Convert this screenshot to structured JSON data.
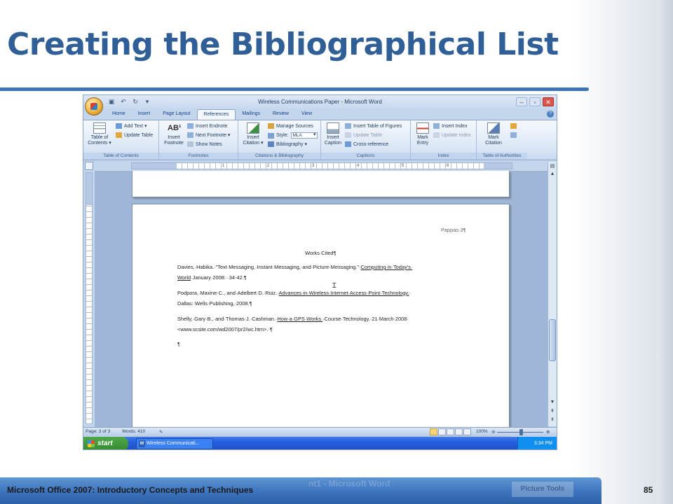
{
  "slide": {
    "title": "Creating the Bibliographical List",
    "footer": "Microsoft Office 2007: Introductory Concepts and Techniques",
    "page_number": "85",
    "footer_ghost_text": "nt1 - Microsoft Word",
    "footer_ghost_tab": "Picture Tools"
  },
  "window": {
    "title": "Wireless Communications Paper - Microsoft Word",
    "controls": {
      "minimize": "–",
      "maximize": "▫",
      "close": "✕"
    },
    "help": "?"
  },
  "ribbon": {
    "tabs": [
      "Home",
      "Insert",
      "Page Layout",
      "References",
      "Mailings",
      "Review",
      "View"
    ],
    "active_tab": "References",
    "groups": {
      "toc": {
        "label": "Table of Contents",
        "toc_button": "Table of Contents ▾",
        "add_text": "Add Text ▾",
        "update_table": "Update Table"
      },
      "footnotes": {
        "label": "Footnotes",
        "insert_footnote": "Insert Footnote",
        "insert_endnote": "Insert Endnote",
        "next_footnote": "Next Footnote ▾",
        "show_notes": "Show Notes"
      },
      "citations": {
        "label": "Citations & Bibliography",
        "insert_citation": "Insert Citation ▾",
        "manage_sources": "Manage Sources",
        "style_label": "Style:",
        "style_value": "MLA",
        "bibliography": "Bibliography ▾"
      },
      "captions": {
        "label": "Captions",
        "insert_caption": "Insert Caption",
        "insert_table_of_figures": "Insert Table of Figures",
        "update_table": "Update Table",
        "cross_reference": "Cross-reference"
      },
      "index": {
        "label": "Index",
        "mark_entry": "Mark Entry",
        "insert_index": "Insert Index",
        "update_index": "Update Index"
      },
      "authorities": {
        "label": "Table of Authorities",
        "mark_citation": "Mark Citation"
      }
    }
  },
  "ruler": {
    "numbers": [
      "1",
      "2",
      "3",
      "4",
      "5",
      "6"
    ]
  },
  "document": {
    "header": "Pappas·3¶",
    "heading": "Works·Cited¶",
    "entries": [
      {
        "line1_a": "Davies,·Habika.·\"Text·Messaging,·Instant·Messaging,·and·Picture·Messaging.\"·",
        "line1_u": "Computing·in·Today's·",
        "line2_u": "World",
        "line2_b": "·January·2008:··34-42.¶"
      },
      {
        "line1_a": "Podpora,·Maxine·C.,·and·Adelbert·D.·Ruiz.·",
        "line1_u": "Advances·in·Wireless·Internet·Access·Point·Technology.",
        "line1_b": "·",
        "line2": "Dallas:·Wells·Publishing,·2008.¶"
      },
      {
        "line1_a": "Shelly,·Gary·B.,·and·Thomas·J.·Cashman.·",
        "line1_u": "How·a·GPS·Works.",
        "line1_b": "·Course·Technology.·21·March·2008·",
        "line2": "<www.scsite.com/wd2007/pr2/wc.htm>.·¶"
      }
    ],
    "empty_paragraph": "¶"
  },
  "statusbar": {
    "page": "Page: 3 of 3",
    "words": "Words: 410",
    "zoom": "100%"
  },
  "taskbar": {
    "start": "start",
    "task": "Wireless Communicati...",
    "clock": "3:34 PM"
  }
}
